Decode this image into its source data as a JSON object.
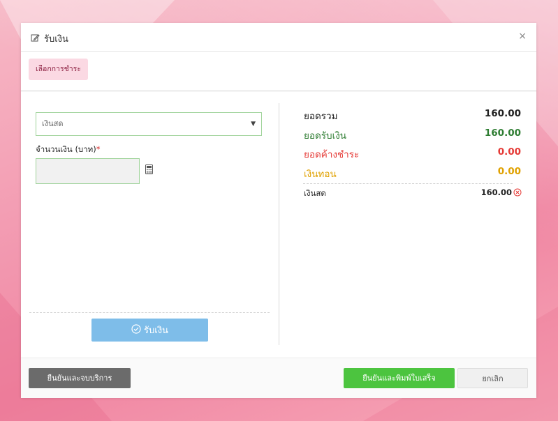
{
  "modal": {
    "title": "รับเงิน",
    "close_label": "×",
    "tab_label": "เลือกการชำระ"
  },
  "form": {
    "payment_type_selected": "เงินสด",
    "amount_label": "จำนวนเงิน (บาท)",
    "required_mark": "*",
    "amount_value": "",
    "receive_button_label": "รับเงิน"
  },
  "summary": {
    "rows": [
      {
        "label": "ยอดรวม",
        "value": "160.00",
        "color": "#222222"
      },
      {
        "label": "ยอดรับเงิน",
        "value": "160.00",
        "color": "#2e7d32"
      },
      {
        "label": "ยอดค้างชำระ",
        "value": "0.00",
        "color": "#e53935"
      },
      {
        "label": "เงินทอน",
        "value": "0.00",
        "color": "#e0a100"
      }
    ],
    "payments": [
      {
        "label": "เงินสด",
        "value": "160.00"
      }
    ]
  },
  "footer": {
    "confirm_end_label": "ยืนยันและจบบริการ",
    "confirm_print_label": "ยืนยันและพิมพ์ใบเสร็จ",
    "cancel_label": "ยกเลิก"
  },
  "colors": {
    "primary_green": "#4cc43f",
    "receive_blue": "#7ebde9",
    "tab_pink": "#fbd9e3"
  }
}
